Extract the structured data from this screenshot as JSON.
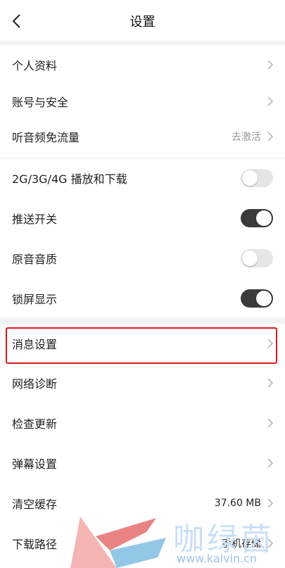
{
  "header": {
    "title": "设置",
    "back_icon": "chevron-left-icon"
  },
  "group_account": {
    "items": [
      {
        "label": "个人资料"
      },
      {
        "label": "账号与安全"
      },
      {
        "label": "听音频免流量",
        "value": "去激活"
      }
    ]
  },
  "group_playback": {
    "items": [
      {
        "label": "2G/3G/4G 播放和下载",
        "toggle": false
      },
      {
        "label": "推送开关",
        "toggle": true
      },
      {
        "label": "原音音质",
        "toggle": false
      },
      {
        "label": "锁屏显示",
        "toggle": true
      }
    ]
  },
  "group_other": {
    "items": [
      {
        "label": "消息设置",
        "highlighted": true
      },
      {
        "label": "网络诊断"
      },
      {
        "label": "检查更新"
      },
      {
        "label": "弹幕设置"
      },
      {
        "label": "清空缓存",
        "value": "37.60 MB"
      },
      {
        "label": "下载路径",
        "value": "手机存储"
      }
    ]
  },
  "watermark": {
    "brand": "咖绿茵",
    "url": "www.kalvin.cn"
  },
  "colors": {
    "highlight": "#e0171d",
    "toggle_on": "#3a3a3a",
    "toggle_off": "#e6e6e6",
    "chevron": "#b8b8b8"
  }
}
